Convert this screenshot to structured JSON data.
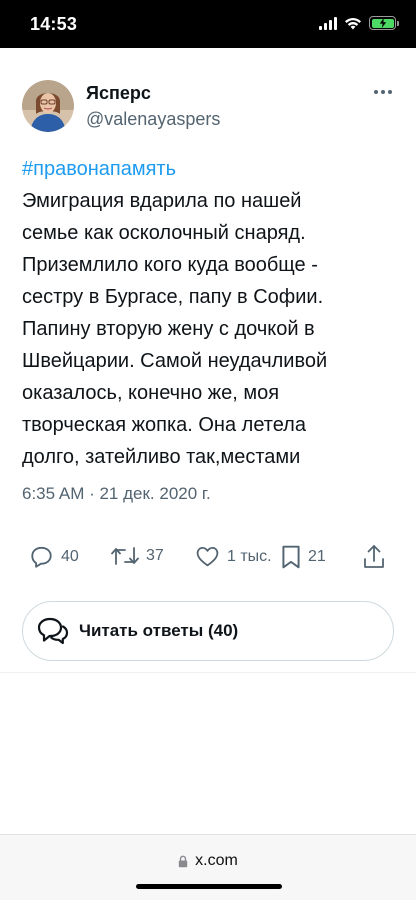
{
  "status_bar": {
    "time": "14:53"
  },
  "tweet": {
    "author": {
      "display_name": "Ясперс",
      "handle": "@valenayaspers"
    },
    "hashtag": "#правонапамять",
    "text": "Эмиграция вдарила по нашей\nсемье как осколочный снаряд.\nПриземлило кого куда вообще -\nсестру в Бургасе, папу в Софии.\nПапину вторую жену с дочкой в\nШвейцарии. Самой неудачливой\nоказалось, конечно же, моя\nтворческая жопка. Она летела\nдолго, затейливо так,местами",
    "timestamp": "6:35 AM · 21 дек. 2020 г."
  },
  "actions": {
    "replies": "40",
    "retweets": "37",
    "likes": "1 тыс.",
    "bookmarks": "21"
  },
  "read_replies_button": {
    "label": "Читать ответы (40)"
  },
  "browser": {
    "url": "x.com"
  },
  "colors": {
    "accent": "#1d9bf0",
    "secondary_text": "#536471",
    "battery": "#4cd964"
  }
}
